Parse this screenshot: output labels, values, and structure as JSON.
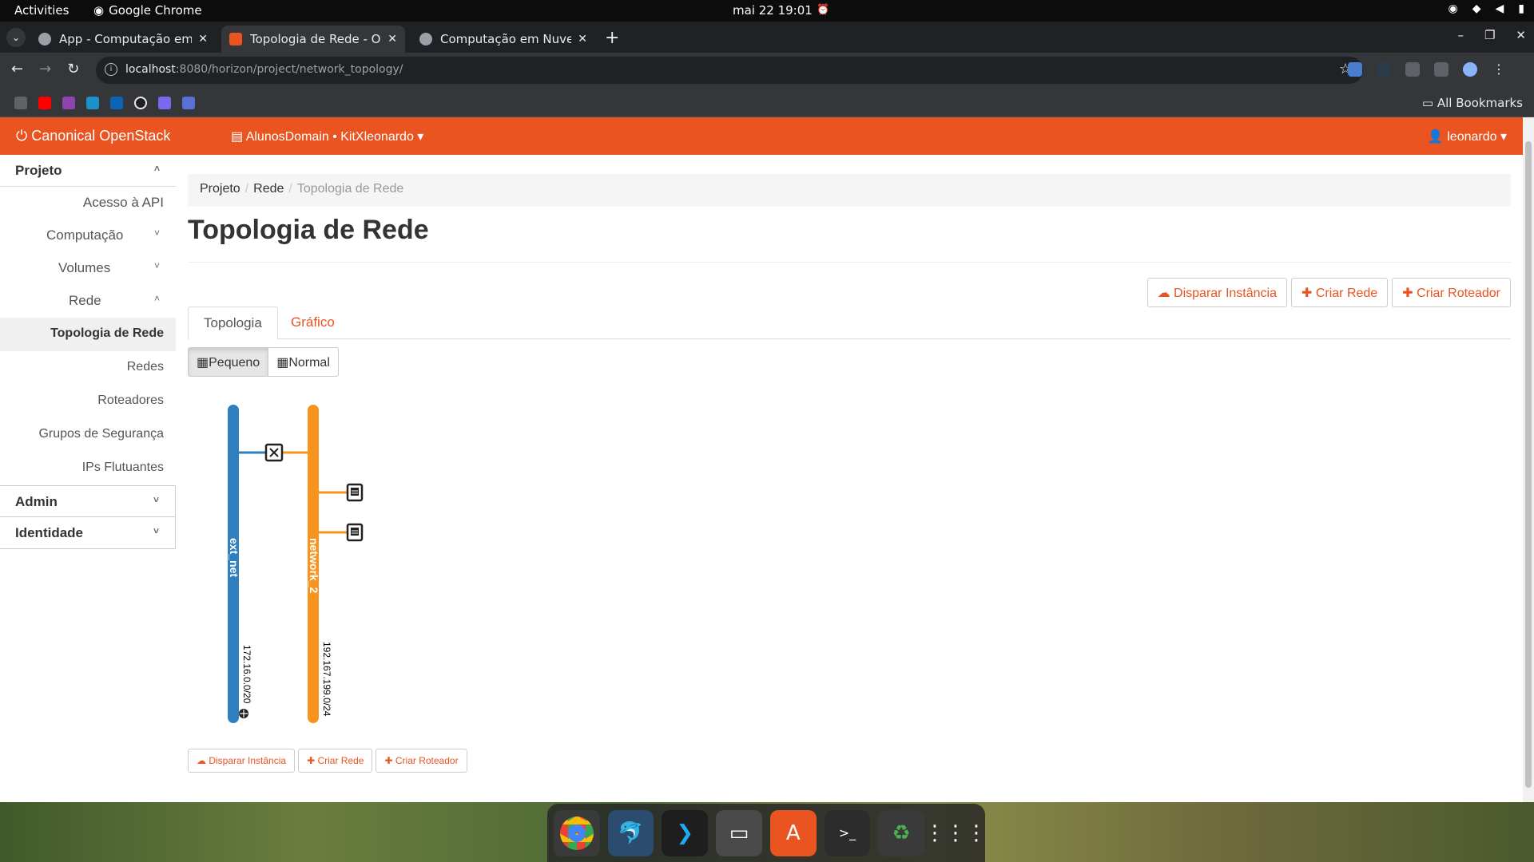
{
  "topbar": {
    "activities": "Activities",
    "app_name": "Google Chrome",
    "clock": "mai 22  19:01"
  },
  "browser": {
    "tabs": [
      {
        "title": "App - Computação em N",
        "color": "#9aa0a6"
      },
      {
        "title": "Topologia de Rede - Ope",
        "color": "#e95420"
      },
      {
        "title": "Computação em Nuvem",
        "color": "#9aa0a6"
      }
    ],
    "address": {
      "host": "localhost",
      "path": ":8080/horizon/project/network_topology/"
    },
    "all_bookmarks": "All Bookmarks"
  },
  "header": {
    "brand": "Canonical OpenStack",
    "context": "AlunosDomain • KitXleonardo",
    "user": "leonardo"
  },
  "sidebar": {
    "projeto": "Projeto",
    "acesso_api": "Acesso à API",
    "computacao": "Computação",
    "volumes": "Volumes",
    "rede": "Rede",
    "items": [
      "Topologia de Rede",
      "Redes",
      "Roteadores",
      "Grupos de Segurança",
      "IPs Flutuantes"
    ],
    "admin": "Admin",
    "identidade": "Identidade"
  },
  "breadcrumb": {
    "projeto": "Projeto",
    "rede": "Rede",
    "current": "Topologia de Rede"
  },
  "page_title": "Topologia de Rede",
  "actions": {
    "launch": "Disparar Instância",
    "create_net": "Criar Rede",
    "create_router": "Criar Roteador"
  },
  "tabs": {
    "topologia": "Topologia",
    "grafico": "Gráfico"
  },
  "size_buttons": {
    "small": "Pequeno",
    "normal": "Normal"
  },
  "topology": {
    "networks": [
      {
        "name": "ext_net",
        "cidr": "172.16.0.0/20",
        "color": "#2e7fbf",
        "external": true
      },
      {
        "name": "network_2",
        "cidr": "192.167.199.0/24",
        "color": "#f7941d",
        "external": false
      }
    ],
    "router_count": 1,
    "instance_count": 2
  },
  "colors": {
    "accent": "#e95420"
  }
}
